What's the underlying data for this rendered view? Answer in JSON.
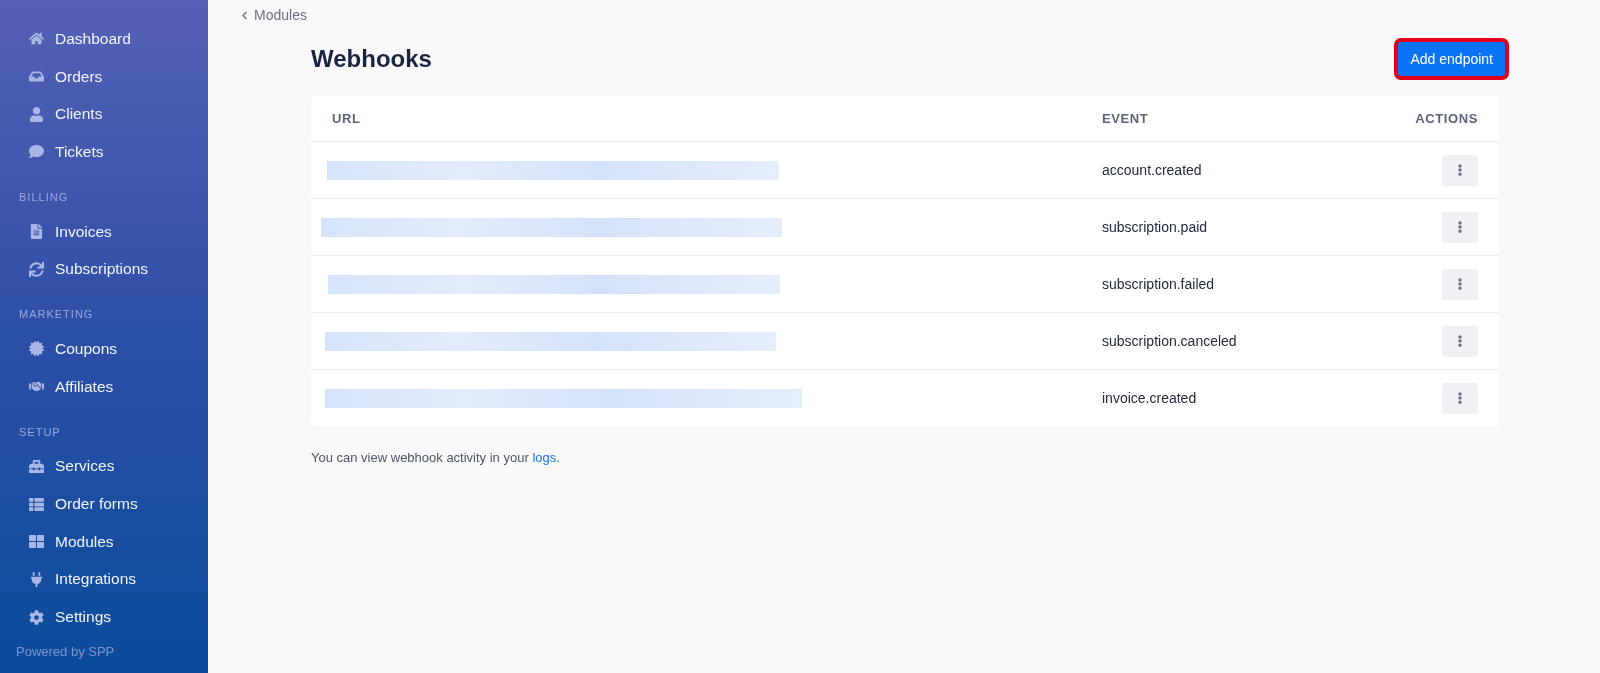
{
  "sidebar": {
    "sections": [
      {
        "items": [
          "Dashboard",
          "Orders",
          "Clients",
          "Tickets"
        ]
      },
      {
        "heading": "BILLING",
        "items": [
          "Invoices",
          "Subscriptions"
        ]
      },
      {
        "heading": "MARKETING",
        "items": [
          "Coupons",
          "Affiliates"
        ]
      },
      {
        "heading": "SETUP",
        "items": [
          "Services",
          "Order forms",
          "Modules",
          "Integrations",
          "Settings"
        ]
      }
    ],
    "footer": "Powered by SPP"
  },
  "breadcrumb": "Modules",
  "title": "Webhooks",
  "add_button": {
    "label": "Add endpoint",
    "highlighted": true
  },
  "table": {
    "columns": [
      "URL",
      "EVENT",
      "ACTIONS"
    ],
    "rows": [
      {
        "event": "account.created"
      },
      {
        "event": "subscription.paid"
      },
      {
        "event": "subscription.failed"
      },
      {
        "event": "subscription.canceled"
      },
      {
        "event": "invoice.created"
      }
    ]
  },
  "footnote": {
    "text": "You can view webhook activity in your",
    "link": "logs",
    "end": "."
  }
}
